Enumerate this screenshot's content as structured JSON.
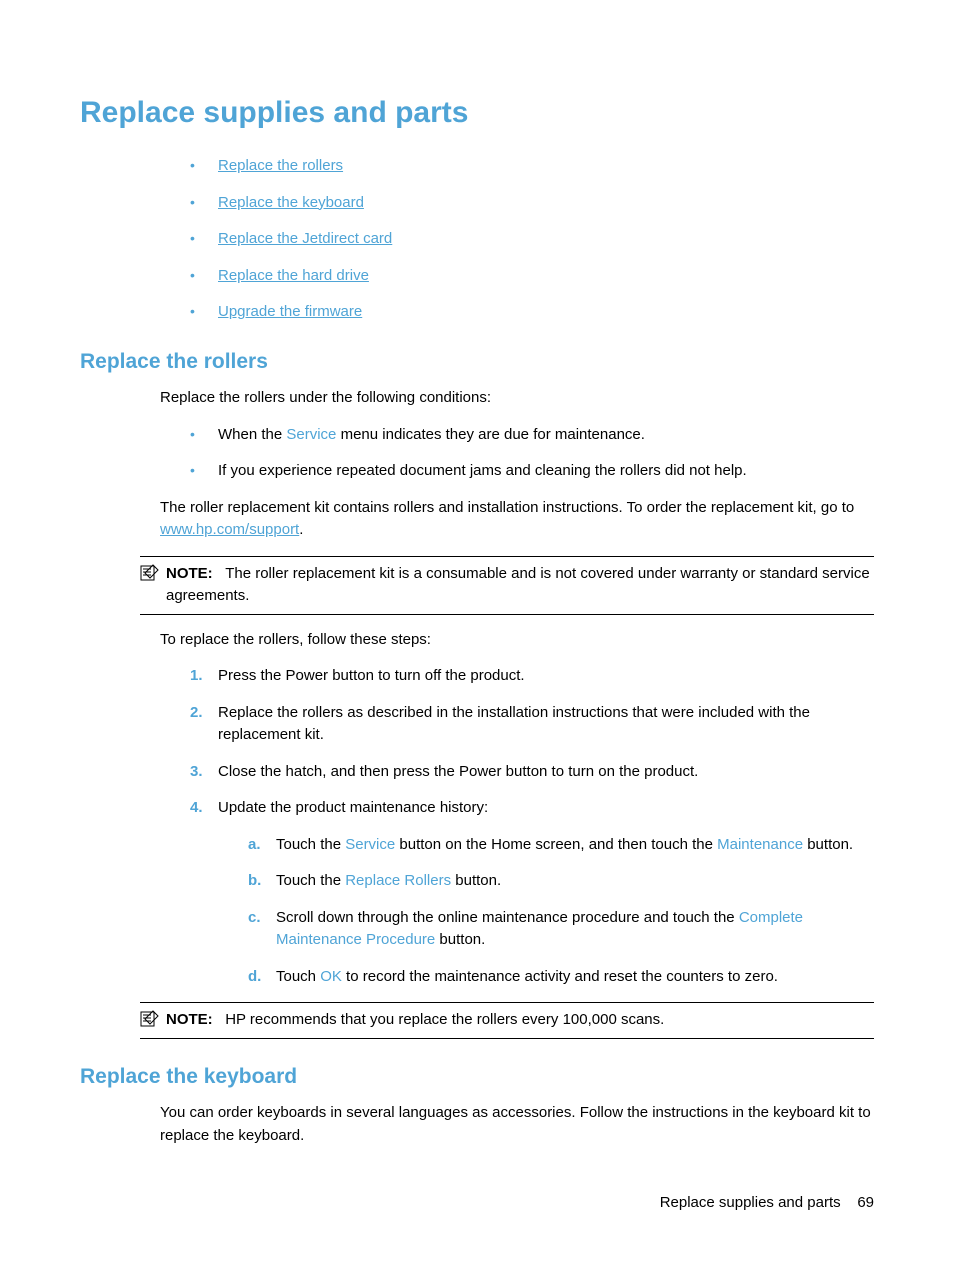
{
  "title": "Replace supplies and parts",
  "toc": [
    "Replace the rollers",
    "Replace the keyboard",
    "Replace the Jetdirect card",
    "Replace the hard drive",
    "Upgrade the firmware"
  ],
  "section1": {
    "heading": "Replace the rollers",
    "intro": "Replace the rollers under the following conditions:",
    "cond1_pre": "When the ",
    "cond1_hl": "Service",
    "cond1_post": " menu indicates they are due for maintenance.",
    "cond2": "If you experience repeated document jams and cleaning the rollers did not help.",
    "kit_pre": "The roller replacement kit contains rollers and installation instructions. To order the replacement kit, go to ",
    "kit_link": "www.hp.com/support",
    "kit_post": ".",
    "note1_label": "NOTE:",
    "note1_text": "The roller replacement kit is a consumable and is not covered under warranty or standard service agreements.",
    "steps_intro": "To replace the rollers, follow these steps:",
    "step1": "Press the Power button to turn off the product.",
    "step2": "Replace the rollers as described in the installation instructions that were included with the replacement kit.",
    "step3": "Close the hatch, and then press the Power button to turn on the product.",
    "step4": "Update the product maintenance history:",
    "sub_a_pre": "Touch the ",
    "sub_a_hl1": "Service",
    "sub_a_mid": " button on the Home screen, and then touch the ",
    "sub_a_hl2": "Maintenance",
    "sub_a_post": " button.",
    "sub_b_pre": "Touch the ",
    "sub_b_hl": "Replace Rollers",
    "sub_b_post": " button.",
    "sub_c_pre": "Scroll down through the online maintenance procedure and touch the ",
    "sub_c_hl": "Complete Maintenance Procedure",
    "sub_c_post": " button.",
    "sub_d_pre": "Touch ",
    "sub_d_hl": "OK",
    "sub_d_post": " to record the maintenance activity and reset the counters to zero.",
    "note2_label": "NOTE:",
    "note2_text": "HP recommends that you replace the rollers every 100,000 scans."
  },
  "section2": {
    "heading": "Replace the keyboard",
    "text": "You can order keyboards in several languages as accessories. Follow the instructions in the keyboard kit to replace the keyboard."
  },
  "footer": {
    "text": "Replace supplies and parts",
    "page": "69"
  }
}
